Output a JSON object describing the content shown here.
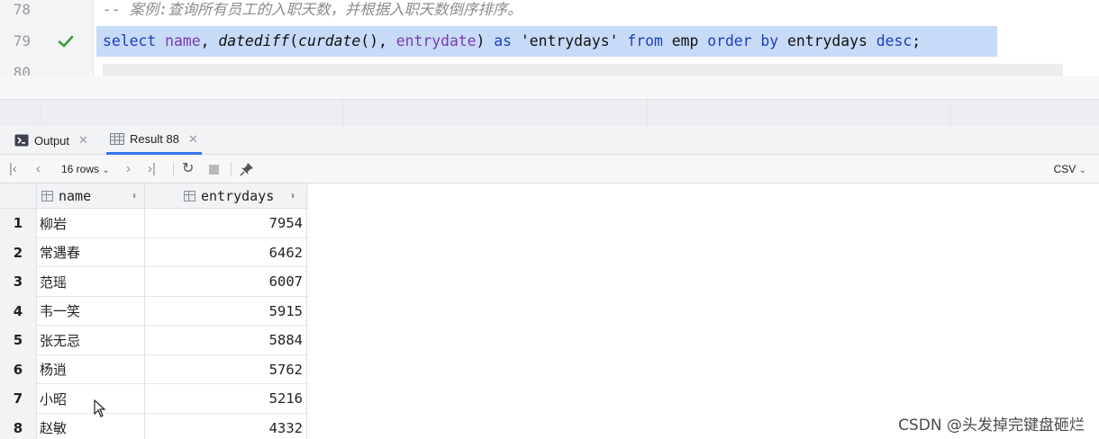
{
  "editor": {
    "lines": [
      {
        "number": "78",
        "text": "-- 案例:查询所有员工的入职天数，并根据入职天数倒序排序。"
      },
      {
        "number": "79",
        "status_icon": "check-icon"
      },
      {
        "number": "80"
      }
    ],
    "sql_tokens": {
      "select": "select",
      "name": "name",
      "comma1": ",",
      "datediff": "datediff",
      "paren_open": "(",
      "curdate": "curdate",
      "curdate_parens": "()",
      "comma2": ",",
      "entrydate": "entrydate",
      "paren_close": ")",
      "as": "as",
      "alias": "'entrydays'",
      "from": "from",
      "emp": "emp",
      "order": "order",
      "by": "by",
      "entrydays": "entrydays",
      "desc": "desc",
      "semicolon": ";"
    }
  },
  "tabs": [
    {
      "label": "Output",
      "icon": "output-icon",
      "active": false
    },
    {
      "label": "Result 88",
      "icon": "table-icon",
      "active": true
    }
  ],
  "toolbar": {
    "rows_label": "16 rows",
    "export_label": "CSV",
    "icons": [
      "first-page-icon",
      "prev-page-icon",
      "next-page-icon",
      "last-page-icon",
      "refresh-icon",
      "stop-icon",
      "pin-icon"
    ]
  },
  "grid": {
    "columns": [
      "name",
      "entrydays"
    ],
    "rows": [
      {
        "num": "1",
        "name": "柳岩",
        "entrydays": "7954"
      },
      {
        "num": "2",
        "name": "常遇春",
        "entrydays": "6462"
      },
      {
        "num": "3",
        "name": "范瑶",
        "entrydays": "6007"
      },
      {
        "num": "4",
        "name": "韦一笑",
        "entrydays": "5915"
      },
      {
        "num": "5",
        "name": "张无忌",
        "entrydays": "5884"
      },
      {
        "num": "6",
        "name": "杨逍",
        "entrydays": "5762"
      },
      {
        "num": "7",
        "name": "小昭",
        "entrydays": "5216"
      },
      {
        "num": "8",
        "name": "赵敏",
        "entrydays": "4332"
      }
    ]
  },
  "watermark": "CSDN @头发掉完键盘砸烂",
  "colors": {
    "highlight": "#c7daf7",
    "keyword": "#1f3fbf",
    "identifier": "#7a3cb0",
    "check": "#3d9a3d",
    "active_tab": "#3574f0"
  }
}
